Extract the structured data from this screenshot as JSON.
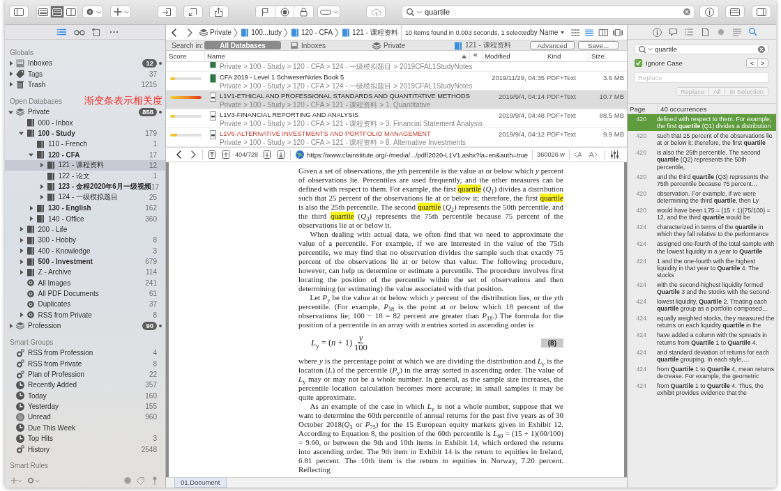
{
  "toolbar": {
    "view_modes": [
      {
        "selected": false
      },
      {
        "selected": true
      },
      {
        "selected": false
      }
    ],
    "search": {
      "value": "quartile"
    }
  },
  "sidebar": {
    "tabs": [
      {
        "selected": true
      },
      {
        "selected": false
      },
      {
        "selected": false
      },
      {
        "selected": false
      }
    ],
    "sections": [
      {
        "title": "Globals",
        "items": [
          {
            "kind": "inbox",
            "label": "Inboxes",
            "count": "12",
            "badge": true,
            "expanded": false,
            "bold": false,
            "selected": false
          },
          {
            "kind": "tag",
            "label": "Tags",
            "count": "37",
            "badge": false,
            "expanded": false,
            "bold": false,
            "selected": false
          },
          {
            "kind": "trash",
            "label": "Trash",
            "count": "1215",
            "badge": false,
            "expanded": false,
            "bold": false,
            "selected": false
          }
        ]
      },
      {
        "title": "Open Databases",
        "annotation": "渐变条表示相关度",
        "items": [
          {
            "kind": "database",
            "label": "Private",
            "count": "858",
            "badge": true,
            "expanded": true,
            "bold": false,
            "selected": false,
            "children": [
              {
                "kind": "group",
                "label": "000 - Inbox",
                "bold": false,
                "selected": false
              },
              {
                "kind": "group",
                "label": "100 - Study",
                "count": "179",
                "badge": false,
                "expanded": true,
                "bold": true,
                "selected": false,
                "children": [
                  {
                    "kind": "group",
                    "label": "110 - French",
                    "count": "1",
                    "badge": false,
                    "bold": false,
                    "selected": false
                  },
                  {
                    "kind": "group",
                    "label": "120 - CFA",
                    "count": "17",
                    "badge": false,
                    "expanded": true,
                    "bold": true,
                    "selected": false,
                    "children": [
                      {
                        "kind": "group",
                        "label": "121 - 课程资料",
                        "count": "12",
                        "badge": false,
                        "expanded": false,
                        "bold": false,
                        "selected": true
                      },
                      {
                        "kind": "group",
                        "label": "122 - 论文",
                        "count": "1",
                        "badge": false,
                        "bold": false,
                        "selected": false
                      },
                      {
                        "kind": "group",
                        "label": "123 - 金程2020年6月一级视频",
                        "count": "17",
                        "badge": false,
                        "expanded": false,
                        "bold": true,
                        "selected": false
                      },
                      {
                        "kind": "group",
                        "label": "124 - 一级模拟题目",
                        "count": "25",
                        "badge": false,
                        "expanded": false,
                        "bold": false,
                        "selected": false
                      }
                    ]
                  },
                  {
                    "kind": "group",
                    "label": "130 - English",
                    "count": "162",
                    "badge": false,
                    "expanded": false,
                    "bold": true,
                    "selected": false
                  },
                  {
                    "kind": "group",
                    "label": "140 - Office",
                    "count": "360",
                    "badge": false,
                    "expanded": false,
                    "bold": false,
                    "selected": false
                  }
                ]
              },
              {
                "kind": "group",
                "label": "200 - Life",
                "expanded": false,
                "bold": false,
                "selected": false
              },
              {
                "kind": "group",
                "label": "300 - Hobby",
                "count": "8",
                "badge": false,
                "expanded": false,
                "bold": false,
                "selected": false
              },
              {
                "kind": "group",
                "label": "400 - Knowledge",
                "count": "3",
                "badge": false,
                "expanded": false,
                "bold": false,
                "selected": false
              },
              {
                "kind": "group",
                "label": "500 - Investment",
                "count": "679",
                "badge": false,
                "expanded": false,
                "bold": true,
                "selected": false
              },
              {
                "kind": "group",
                "label": "Z - Archive",
                "count": "114",
                "badge": false,
                "expanded": false,
                "bold": false,
                "selected": false
              },
              {
                "kind": "smart",
                "label": "All Images",
                "count": "241",
                "badge": false,
                "bold": false,
                "selected": false
              },
              {
                "kind": "smart",
                "label": "All PDF Documents",
                "count": "61",
                "badge": false,
                "bold": false,
                "selected": false
              },
              {
                "kind": "smart",
                "label": "Duplicates",
                "count": "37",
                "badge": false,
                "bold": false,
                "selected": false
              },
              {
                "kind": "smart",
                "label": "RSS from Private",
                "count": "8",
                "badge": false,
                "expanded": false,
                "bold": false,
                "selected": false
              }
            ]
          },
          {
            "kind": "database",
            "label": "Profession",
            "count": "90",
            "badge": true,
            "expanded": false,
            "bold": false,
            "selected": false
          }
        ]
      },
      {
        "title": "Smart Groups",
        "items": [
          {
            "kind": "smartgroup",
            "label": "RSS from Profession",
            "count": "4",
            "badge": false,
            "bold": false,
            "selected": false
          },
          {
            "kind": "smartgroup",
            "label": "RSS from Private",
            "count": "8",
            "badge": false,
            "bold": false,
            "selected": false
          },
          {
            "kind": "smartgroup",
            "label": "Plan of Profession",
            "count": "22",
            "badge": false,
            "bold": false,
            "selected": false
          },
          {
            "kind": "clock",
            "label": "Recently Added",
            "count": "357",
            "badge": false,
            "bold": false,
            "selected": false
          },
          {
            "kind": "clock",
            "label": "Today",
            "count": "160",
            "badge": false,
            "bold": false,
            "selected": false
          },
          {
            "kind": "clock",
            "label": "Yesterday",
            "count": "155",
            "badge": false,
            "bold": false,
            "selected": false
          },
          {
            "kind": "unread",
            "label": "Unread",
            "count": "960",
            "badge": false,
            "bold": false,
            "selected": false
          },
          {
            "kind": "clock",
            "label": "Due This Week",
            "bold": false,
            "selected": false
          },
          {
            "kind": "clock",
            "label": "Top Hits",
            "count": "3",
            "badge": false,
            "bold": false,
            "selected": false
          },
          {
            "kind": "smartgroup",
            "label": "History",
            "count": "2548",
            "badge": false,
            "bold": false,
            "selected": false
          }
        ]
      },
      {
        "title": "Smart Rules"
      }
    ]
  },
  "browser": {
    "path": {
      "crumbs": [
        {
          "kind": "database",
          "label": "Private"
        },
        {
          "kind": "group",
          "label": "100...tudy"
        },
        {
          "kind": "group",
          "label": "120 - CFA"
        },
        {
          "kind": "group",
          "label": "121 - 课程资料"
        }
      ],
      "status": "10 items found in 0.003 seconds, 1 selected",
      "sort": "by Name",
      "view_modes": [
        {
          "selected": false
        },
        {
          "selected": true
        },
        {
          "selected": false
        },
        {
          "selected": false
        }
      ]
    },
    "search_in": {
      "label": "Search in:",
      "scopes": [
        {
          "kind": "all",
          "label": "All Databases",
          "selected": true
        },
        {
          "kind": "inbox",
          "label": "Inboxes",
          "selected": false
        },
        {
          "kind": "database",
          "label": "Private",
          "selected": false
        },
        {
          "kind": "group",
          "label": "121 - 课程资料",
          "selected": false
        }
      ],
      "buttons": [
        "Advanced",
        "Save..."
      ]
    },
    "table": {
      "columns": [
        {
          "label": "Score",
          "sorted": false
        },
        {
          "label": "Name",
          "sorted": true
        },
        {
          "label": "Modified",
          "sorted": false
        },
        {
          "label": "Kind",
          "sorted": false
        },
        {
          "label": "Size",
          "sorted": false
        }
      ],
      "rows": [
        {
          "kind": "book",
          "path": "Private > 100 - Study > 120 - CFA > 124 - 一级模拟题目 > 2019CFAL1StudyNotes",
          "selected": false
        },
        {
          "kind": "book",
          "name": "CFA 2019 - Level 1 SchweserNotes Book 5",
          "path": "Private > 100 - Study > 120 - CFA > 124 - 一级模拟题目 > 2019CFAL1StudyNotes",
          "modified": "2019/11/29, 04:35",
          "type": "PDF+Text",
          "size": "3.6 MB",
          "level": 0.15,
          "selected": false
        },
        {
          "kind": "pdf",
          "name": "L1V1-ETHICAL AND PROFESSIONAL STANDARDS AND QUANTITATIVE METHODS",
          "path": "Private > 100 - Study > 120 - CFA > 121 - 课程资料 > 1. Quantitative",
          "modified": "2019/9/4, 04:14",
          "type": "PDF+Text",
          "size": "10.7 MB",
          "level": 1,
          "selected": true
        },
        {
          "kind": "pdf",
          "name": "L1V3-FINANCIAL REPORTING AND ANALYSIS",
          "path": "Private > 100 - Study > 120 - CFA > 121 - 课程资料 > 3. Financial Statement Analysis",
          "modified": "2019/9/4, 04:48",
          "type": "PDF+Text",
          "size": "88.5 MB",
          "level": 0.15,
          "selected": false
        },
        {
          "kind": "pdf",
          "name": "L1V6-ALTERNATIVE INVESTMENTS AND PORTFOLIO MANAGEMENT",
          "color": "#c0392b",
          "path": "Private > 100 - Study > 120 - CFA > 121 - 课程资料 > 8. Alternative Investments",
          "modified": "2019/9/4, 04:12",
          "type": "PDF+Text",
          "size": "9.9 MB",
          "level": 0.22,
          "selected": false
        }
      ]
    },
    "doc_toolbar": {
      "page": "404/728",
      "url": "https://www.cfainstitute.org/-/media/.../pdf/2020-L1V1.ashx?la=en&auth=true",
      "words": "360026 w",
      "font_smaller": "A",
      "font_larger": "A"
    },
    "document": {
      "paragraphs": [
        {
          "kind": "text",
          "indent": false,
          "segments": [
            {
              "text": "Given a set of observations, the ",
              "highlight": false
            },
            {
              "text": "*y*",
              "highlight": false
            },
            {
              "text": "th percentile is the value at or below which *y* percent of observations lie. Percentiles are used frequently, and the other measures can be defined with respect to them. For example, the first ",
              "highlight": false
            },
            {
              "text": "quartile",
              "highlight": true
            },
            {
              "text": " (*Q*$_{1}$) divides a distribution such that 25 percent of the observations lie at or below it; therefore, the first ",
              "highlight": false
            },
            {
              "text": "quartile",
              "highlight": true
            },
            {
              "text": " is also the 25th percentile. The second ",
              "highlight": false
            },
            {
              "text": "quartile",
              "highlight": true
            },
            {
              "text": " (*Q*$_{2}$) represents the 50th percentile, and the third ",
              "highlight": false
            },
            {
              "text": "quartile",
              "highlight": true
            },
            {
              "text": " (*Q*$_{3}$) represents the 75th percentile because 75 percent of the observations lie at or below it.",
              "highlight": false
            }
          ]
        },
        {
          "kind": "text",
          "indent": true,
          "segments": [
            {
              "text": "When dealing with actual data, we often find that we need to approximate the value of a percentile. For example, if we are interested in the value of the 75th percentile, we may find that no observation divides the sample such that exactly 75 percent of the observations lie at or below that value. The following procedure, however, can help us determine or estimate a percentile. The procedure involves first locating the position of the percentile within the set of observations and then determining (or estimating) the value associated with that position.",
              "highlight": false
            }
          ]
        },
        {
          "kind": "text",
          "indent": true,
          "segments": [
            {
              "text": "Let *P*$_{y}$ be the value at or below which *y* percent of the distribution lies, or the ",
              "highlight": false
            },
            {
              "text": "*y*",
              "highlight": false
            },
            {
              "text": "th percentile. (For example, *P*$_{18}$ is the point at or below which 18 percent of the observations lie; 100 − 18 = 82 percent are greater than *P*$_{18}$.) The formula for the position of a percentile in an array with *n* entries sorted in ascending order is",
              "highlight": false
            }
          ]
        },
        {
          "kind": "equation",
          "lhs": "*L*$_{y}$ = (*n* + 1)",
          "numerator": "*y*",
          "denominator": "100",
          "number": "(8)"
        },
        {
          "kind": "text",
          "indent": false,
          "segments": [
            {
              "text": "where *y* is the percentage point at which we are dividing the distribution and *L*$_{y}$ is the location (*L*) of the percentile (*P*$_{y}$) in the array sorted in ascending order. The value of *L*$_{y}$ may or may not be a whole number. In general, as the sample size increases, the percentile location calculation becomes more accurate; in small samples it may be quite approximate.",
              "highlight": false
            }
          ]
        },
        {
          "kind": "text",
          "indent": true,
          "segments": [
            {
              "text": "As an example of the case in which *L*$_{y}$ is not a whole number, suppose that we want to determine the 60th percentile of annual returns for the past five years as of 30 October 2018(*Q*$_{3}$ or *P*$_{75}$) for the 15 European equity markets given in Exhibit 12. According to Equation 8, the position of the 60th percentile is *L*$_{60}$ = (15 + 1)(60/100) = 9.60, or between the 9th and 10th items in Exhibit 14, which ordered the returns into ascending order. The 9th item in Exhibit 14 is the return to equities in Ireland, 6.81 percent. The 10th item is the return to equities in Norway, 7.20 percent. Reflecting",
              "highlight": false
            }
          ]
        }
      ]
    },
    "tabs": [
      {
        "label": "01.Document",
        "selected": true
      }
    ]
  },
  "inspector": {
    "tabs": [
      {
        "selected": false
      },
      {
        "selected": false
      },
      {
        "selected": false
      },
      {
        "selected": false
      },
      {
        "selected": false
      },
      {
        "selected": false
      },
      {
        "selected": true
      }
    ],
    "search": {
      "value": "quartile"
    },
    "ignore_case": {
      "label": "Ignore Case",
      "checked": true
    },
    "nav": [
      "<",
      ">"
    ],
    "replace": {
      "placeholder": "Replace"
    },
    "buttons": [
      {
        "label": "Replace",
        "disabled": true
      },
      {
        "label": "All",
        "disabled": true
      },
      {
        "label": "In Selection",
        "disabled": true
      }
    ],
    "columns": [
      "Page",
      "40 occurrences"
    ],
    "occurrences": [
      {
        "page": "420",
        "text": "defined with respect to them. For example, the first **quartile** (Q1) divides a distribution",
        "selected": true
      },
      {
        "page": "420",
        "text": "such that 25 percent of the observations lie at or below it; therefore, the first **quartile**",
        "selected": false
      },
      {
        "page": "420",
        "text": "is also the 25th percentile. The second **quartile** (Q2) represents the 50th percentile,",
        "selected": false
      },
      {
        "page": "420",
        "text": "and the third **quartile** (Q3) represents the 75th percentile because 75 percent…",
        "selected": false
      },
      {
        "page": "420",
        "text": "observation. For example, if we were determining the third **quartile**, then Ly",
        "selected": false
      },
      {
        "page": "420",
        "text": "would have been L75 = (15 + 1)(75/100) = 12, and the third **quartile** would be",
        "selected": false
      },
      {
        "page": "424",
        "text": "characterized in terms of the **quartile** in which they fall relative to the performance",
        "selected": false
      },
      {
        "page": "424",
        "text": "assigned one-fourth of the total sample with the lowest liquidity in a year to **Quartile**",
        "selected": false
      },
      {
        "page": "424",
        "text": "1 and the one-fourth with the highest liquidity in that year to **Quartile** 4. The stocks",
        "selected": false
      },
      {
        "page": "424",
        "text": "with the second-highest liquidity formed **Quartile** 3 and the stocks with the second-",
        "selected": false
      },
      {
        "page": "424",
        "text": "lowest liquidity, **Quartile** 2. Treating each **quartile** group as a portfolio composed…",
        "selected": false
      },
      {
        "page": "424",
        "text": "equally weighted stocks, they measured the returns on each liquidity **quartile** in the",
        "selected": false
      },
      {
        "page": "424",
        "text": "have added a column with the spreads in returns from **Quartile** 1 to **Quartile** 4.",
        "selected": false
      },
      {
        "page": "424",
        "text": "and standard deviation of returns for each **quartile** grouping. In each style,…",
        "selected": false
      },
      {
        "page": "424",
        "text": "from **Quartile** 1 to **Quartile** 4, mean returns decrease. For example, the geometric",
        "selected": false
      },
      {
        "page": "424",
        "text": "from **Quartile** 1 to **Quartile** 4. Thus, the exhibit provides evidence that the",
        "selected": false
      }
    ]
  }
}
